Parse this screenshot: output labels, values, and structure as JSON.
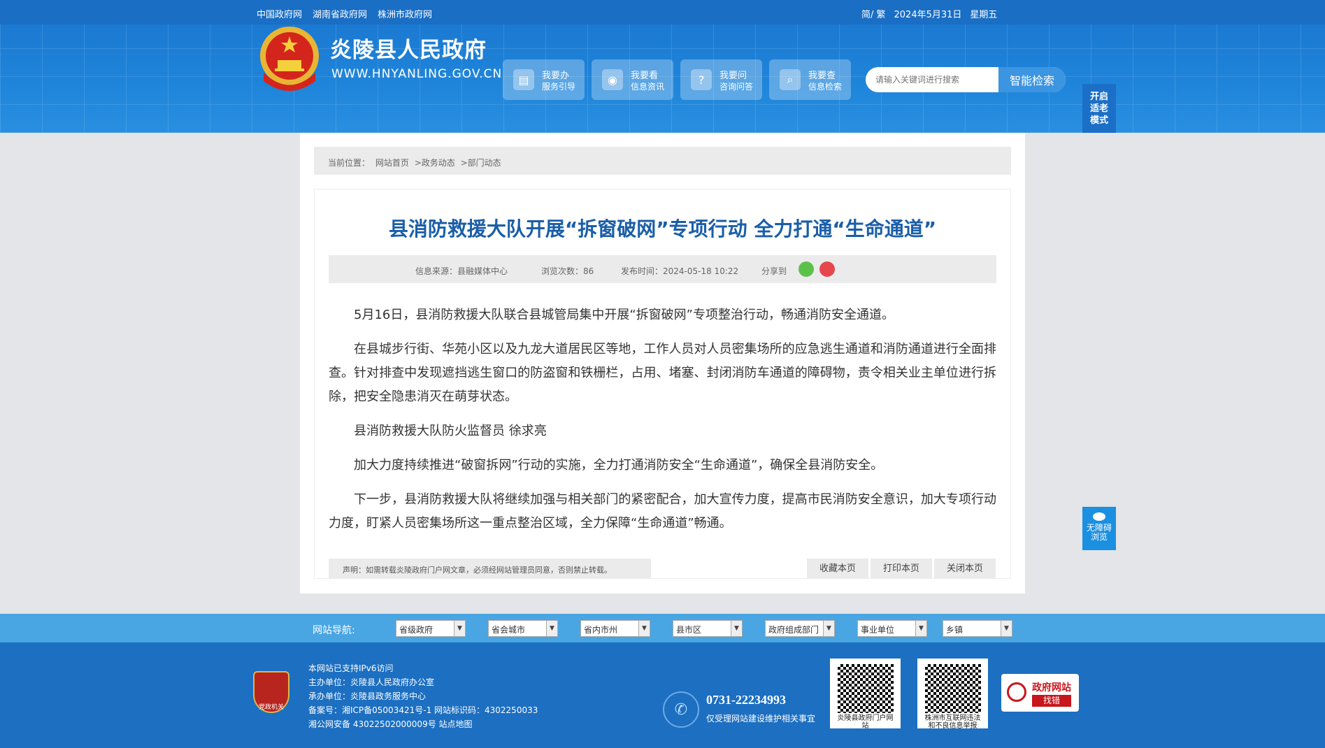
{
  "topbar": {
    "links": [
      "中国政府网",
      "湖南省政府网",
      "株洲市政府网"
    ],
    "lang": "简/ 繁",
    "date": "2024年5月31日",
    "weekday": "星期五"
  },
  "header": {
    "title": "炎陵县人民政府",
    "domain": "WWW.HNYANLING.GOV.CN",
    "services": [
      {
        "l1": "我要办",
        "l2": "服务引导",
        "icon": "document-icon"
      },
      {
        "l1": "我要看",
        "l2": "信息资讯",
        "icon": "eye-icon"
      },
      {
        "l1": "我要问",
        "l2": "咨询问答",
        "icon": "question-icon"
      },
      {
        "l1": "我要查",
        "l2": "信息检索",
        "icon": "search-icon"
      }
    ],
    "search_placeholder": "请输入关键词进行搜索",
    "search_button": "智能检索",
    "elder_mode": "开启适老模式"
  },
  "breadcrumb": {
    "prefix": "当前位置：",
    "items": [
      "网站首页",
      ">政务动态",
      ">部门动态"
    ]
  },
  "article": {
    "title": "县消防救援大队开展“拆窗破网”专项行动 全力打通“生命通道”",
    "source": "信息来源：县融媒体中心",
    "views": "浏览次数：86",
    "published": "发布时间：2024-05-18 10:22",
    "share_label": "分享到",
    "paragraphs": [
      "5月16日，县消防救援大队联合县城管局集中开展“拆窗破网”专项整治行动，畅通消防安全通道。",
      "在县城步行街、华苑小区以及九龙大道居民区等地，工作人员对人员密集场所的应急逃生通道和消防通道进行全面排查。针对排查中发现遮挡逃生窗口的防盗窗和铁栅栏，占用、堵塞、封闭消防车通道的障碍物，责令相关业主单位进行拆除，把安全隐患消灭在萌芽状态。",
      "县消防救援大队防火监督员 徐求亮",
      "加大力度持续推进“破窗拆网”行动的实施，全力打通消防安全“生命通道”，确保全县消防安全。",
      "下一步，县消防救援大队将继续加强与相关部门的紧密配合，加大宣传力度，提高市民消防安全意识，加大专项行动力度，盯紧人员密集场所这一重点整治区域，全力保障“生命通道”畅通。"
    ],
    "statement": "声明：如需转载炎陵政府门户网文章，必须经网站管理员同意，否则禁止转载。",
    "actions": [
      "收藏本页",
      "打印本页",
      "关闭本页"
    ]
  },
  "accessibility": "无障碍浏览",
  "site_nav": {
    "label": "网站导航:",
    "selects": [
      "省级政府",
      "省会城市",
      "省内市州",
      "县市区",
      "政府组成部门",
      "事业单位",
      "乡镇"
    ]
  },
  "footer": {
    "badge": "党政机关",
    "lines": [
      "本网站已支持IPv6访问",
      "主办单位：炎陵县人民政府办公室",
      "承办单位：炎陵县政务服务中心",
      "备案号：湘ICP备05003421号-1 网站标识码：4302250033",
      "湘公网安备 43022502000009号 站点地图"
    ],
    "phone": "0731-22234993",
    "phone_note": "仅受理网站建设维护相关事宜",
    "qr1_caption": "炎陵县政府门户网站",
    "qr2_caption": "株洲市互联网违法和不良信息举报",
    "findbug_title": "政府网站",
    "findbug_sub": "找错"
  },
  "colors": {
    "brand_blue": "#1a6ec4",
    "title_blue": "#1a5ea8",
    "nav_blue": "#4aa5e3",
    "red": "#c8161d"
  }
}
